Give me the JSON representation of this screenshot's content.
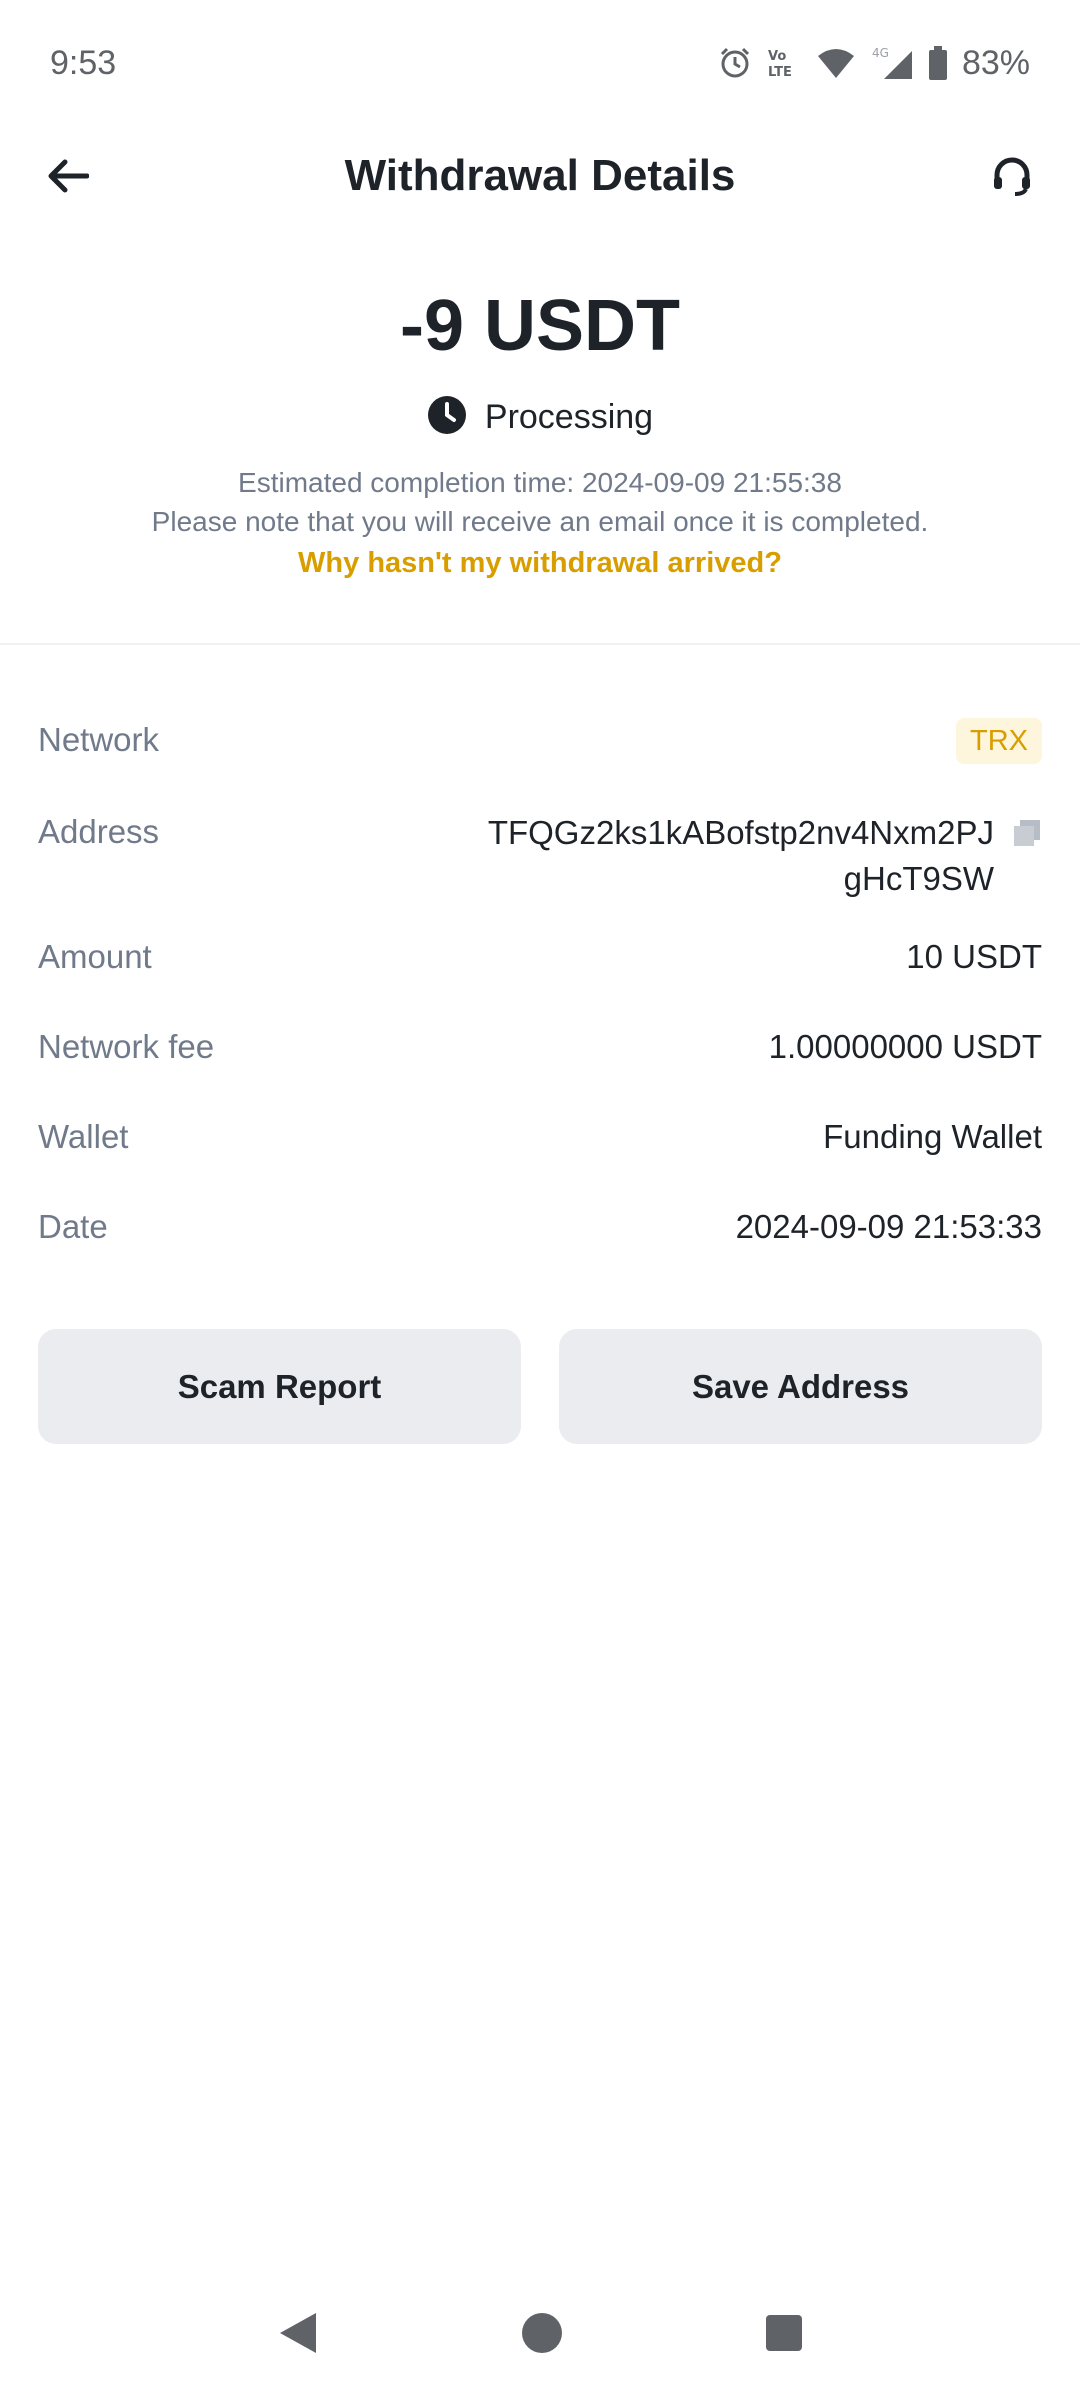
{
  "status_bar": {
    "time": "9:53",
    "network_label": "4G",
    "volte_label": "Vo LTE",
    "battery": "83%",
    "icons": [
      "alarm-icon",
      "volte-icon",
      "wifi-icon",
      "signal-icon",
      "battery-icon"
    ]
  },
  "header": {
    "title": "Withdrawal Details",
    "back_icon": "arrow-left-icon",
    "support_icon": "headset-icon"
  },
  "summary": {
    "amount": "-9 USDT",
    "status": "Processing",
    "status_icon": "clock-icon",
    "estimated": "Estimated completion time: 2024-09-09 21:55:38",
    "notice": "Please note that you will receive an email once it is completed.",
    "help_link": "Why hasn't my withdrawal arrived?"
  },
  "details": {
    "network": {
      "label": "Network",
      "value": "TRX"
    },
    "address": {
      "label": "Address",
      "value": "TFQGz2ks1kABofstp2nv4Nxm2PJgHcT9SW"
    },
    "amount": {
      "label": "Amount",
      "value": "10 USDT"
    },
    "fee": {
      "label": "Network fee",
      "value": "1.00000000 USDT"
    },
    "wallet": {
      "label": "Wallet",
      "value": "Funding Wallet"
    },
    "date": {
      "label": "Date",
      "value": "2024-09-09 21:53:33"
    }
  },
  "actions": {
    "scam_report": "Scam Report",
    "save_address": "Save Address"
  },
  "colors": {
    "accent": "#d89e00",
    "text_primary": "#1e2329",
    "text_secondary": "#707a8a",
    "button_bg": "#eaecef"
  }
}
